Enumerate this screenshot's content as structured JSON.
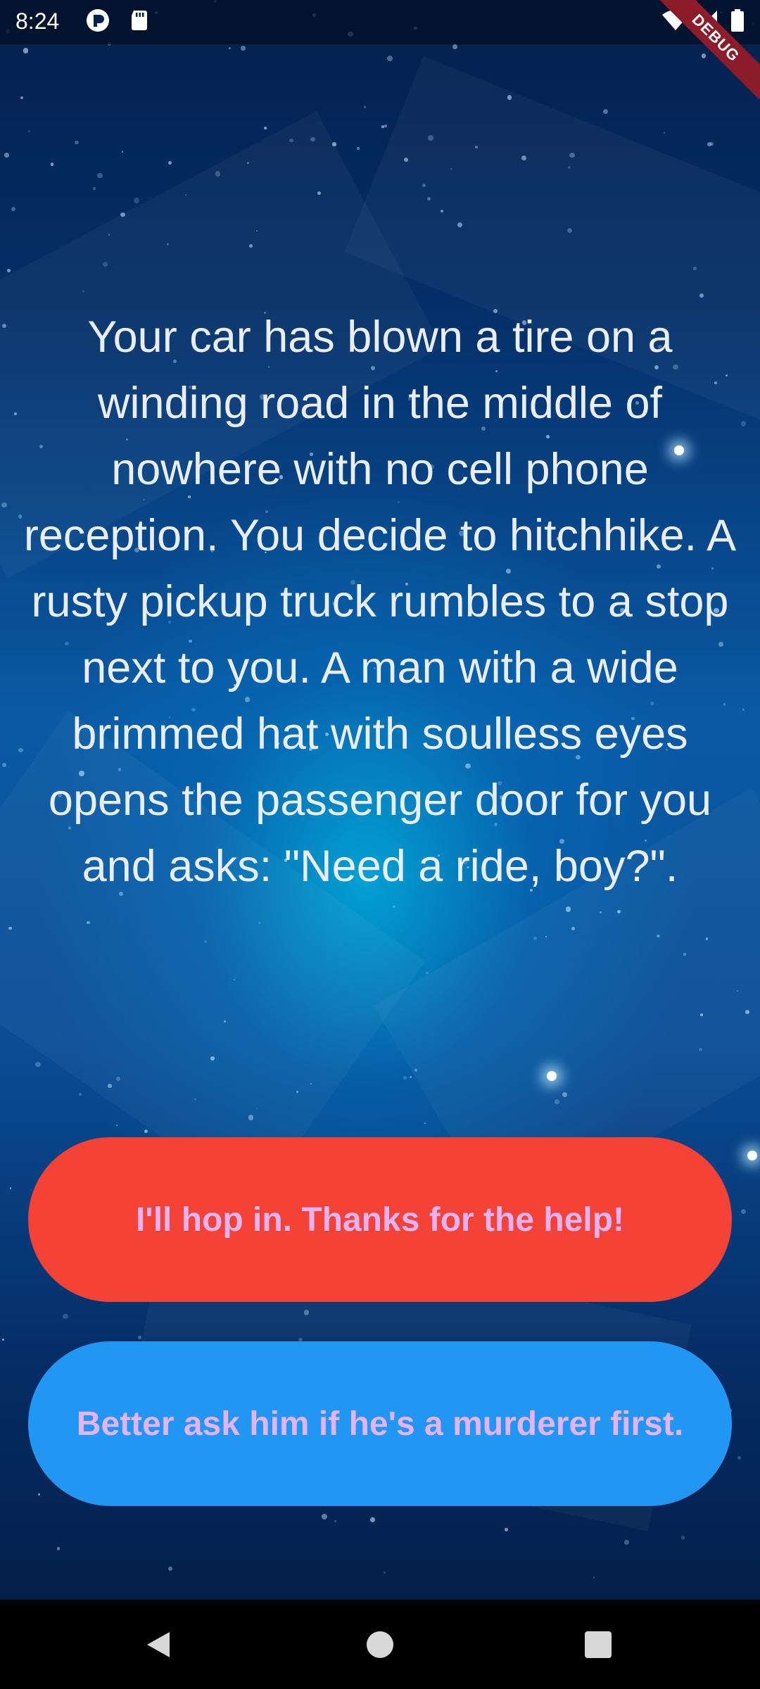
{
  "status_bar": {
    "time": "8:24",
    "left_icons": [
      "sync-icon",
      "sd-card-icon"
    ],
    "right_icons": [
      "wifi-icon",
      "cell-signal-icon",
      "battery-icon"
    ],
    "debug_label": "DEBUG"
  },
  "story": {
    "text": "Your car has blown a tire on a winding road in the middle of nowhere with no cell phone reception. You decide to hitchhike. A rusty pickup truck rumbles to a stop next to you. A man with a wide brimmed hat with soulless eyes opens the passenger door for you and asks: \"Need a ride, boy?\"."
  },
  "choices": {
    "choice1": "I'll hop in. Thanks for the help!",
    "choice2": "Better ask him if he's a murderer first."
  },
  "colors": {
    "choice1_bg": "#f44336",
    "choice2_bg": "#2196f3",
    "choice_text": "#e5b3f0"
  },
  "nav_bar": {
    "buttons": [
      "back-icon",
      "home-icon",
      "recents-icon"
    ]
  }
}
